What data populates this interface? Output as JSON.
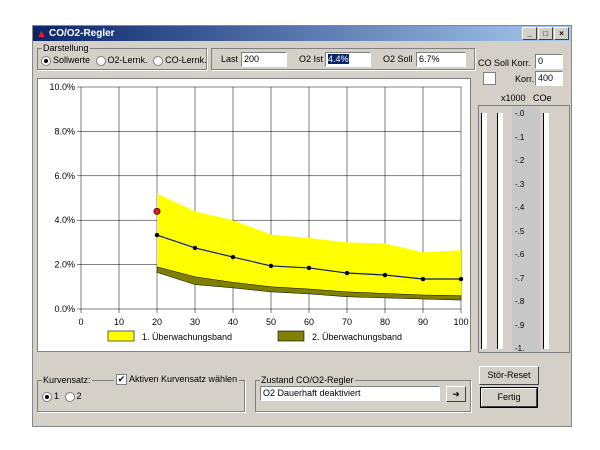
{
  "window": {
    "title": "CO/O2-Regler",
    "minimize": "_",
    "maximize": "□",
    "close": "×"
  },
  "darstellung": {
    "label": "Darstellung",
    "options": [
      "Sollwerte",
      "O2-Lernk.",
      "CO-Lernk."
    ],
    "selected": 0
  },
  "fields": {
    "last_label": "Last",
    "last": "200",
    "o2ist_label": "O2 Ist",
    "o2ist": "4.4%",
    "o2soll_label": "O2 Soll",
    "o2soll": "6.7%"
  },
  "right": {
    "co_soll_korr_label": "CO Soll Korr.",
    "co_soll_korr": "0",
    "korr_label": "Korr.",
    "korr": "400",
    "korr_checked": false,
    "scale_label_left": "x1000",
    "scale_label_right": "COe",
    "scale_ticks": [
      "-.0",
      "-.1",
      "-.2",
      "-.3",
      "-.4",
      "-.5",
      "-.6",
      "-.7",
      "-.8",
      "-.9",
      "-1."
    ],
    "stoer_reset": "Stör-Reset",
    "fertig": "Fertig"
  },
  "chart_data": {
    "type": "area",
    "x_ticks": [
      "0",
      "10",
      "20",
      "30",
      "40",
      "50",
      "60",
      "70",
      "80",
      "90",
      "100"
    ],
    "y_ticks": [
      "0.0%",
      "2.0%",
      "4.0%",
      "6.0%",
      "8.0%",
      "10.0%"
    ],
    "xlim": [
      0,
      100
    ],
    "ylim": [
      0,
      10
    ],
    "grid": true,
    "x": [
      20,
      30,
      40,
      50,
      60,
      70,
      80,
      90,
      100
    ],
    "band1": {
      "name": "1. Überwachungsband",
      "color": "#ffff00",
      "upper": [
        5.2,
        4.4,
        4.0,
        3.35,
        3.2,
        3.0,
        2.95,
        2.55,
        2.65
      ],
      "lower": [
        1.9,
        1.45,
        1.2,
        1.0,
        0.9,
        0.77,
        0.7,
        0.63,
        0.6
      ]
    },
    "band2": {
      "name": "2. Überwachungsband",
      "color": "#808000",
      "upper": [
        1.9,
        1.45,
        1.2,
        1.0,
        0.9,
        0.77,
        0.7,
        0.63,
        0.6
      ],
      "lower": [
        1.65,
        1.1,
        0.95,
        0.77,
        0.68,
        0.55,
        0.5,
        0.45,
        0.4
      ]
    },
    "setpoint_line": [
      3.33,
      2.75,
      2.34,
      1.94,
      1.85,
      1.62,
      1.53,
      1.35,
      1.35
    ],
    "current_point": {
      "x": 20,
      "y": 4.4,
      "color": "#e02020"
    },
    "legend_placement": "bottom"
  },
  "kurvensatz": {
    "label": "Kurvensatz:",
    "check_label": "Aktiven Kurvensatz wählen",
    "checked": true,
    "options": [
      "1",
      "2"
    ],
    "selected": 0
  },
  "zustand": {
    "label": "Zustand CO/O2-Regler",
    "value": "O2 Dauerhaft deaktiviert",
    "arrow": "➜"
  }
}
